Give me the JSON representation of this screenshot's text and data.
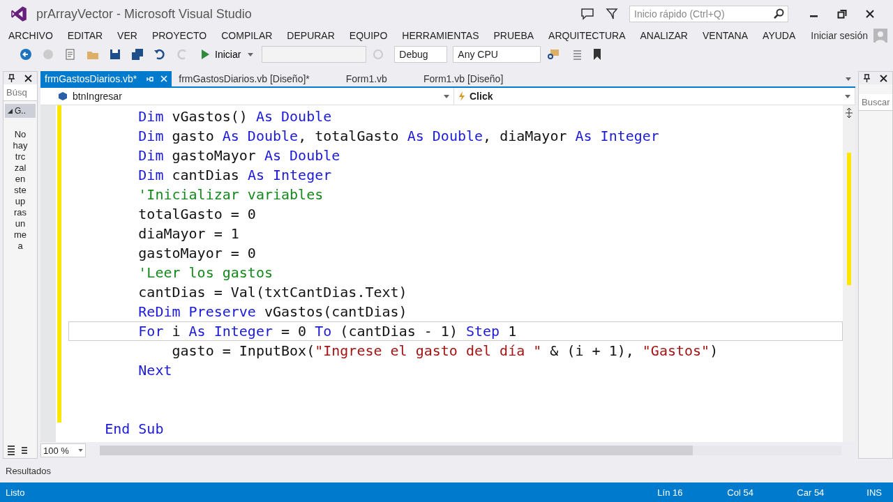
{
  "window": {
    "title": "prArrayVector - Microsoft Visual Studio",
    "quick_launch": {
      "placeholder": "Inicio rápido (Ctrl+Q)"
    }
  },
  "menu": [
    "ARCHIVO",
    "EDITAR",
    "VER",
    "PROYECTO",
    "COMPILAR",
    "DEPURAR",
    "EQUIPO",
    "HERRAMIENTAS",
    "PRUEBA",
    "ARQUITECTURA",
    "ANALIZAR",
    "VENTANA",
    "AYUDA"
  ],
  "sign_in": "Iniciar sesión",
  "toolbar": {
    "start": "Iniciar",
    "configuration": "Debug",
    "platform": "Any CPU"
  },
  "left_panel": {
    "search": {
      "placeholder": "Búsq"
    },
    "group": "G..",
    "message": [
      "No",
      "hay",
      "trc",
      "zal",
      "en",
      "ste",
      "up",
      "ras",
      "un",
      "me",
      "a"
    ]
  },
  "tabs": [
    {
      "label": "frmGastosDiarios.vb*",
      "selected": true
    },
    {
      "label": "frmGastosDiarios.vb [Diseño]*",
      "selected": false
    },
    {
      "label": "Form1.vb",
      "selected": false
    },
    {
      "label": "Form1.vb [Diseño]",
      "selected": false
    }
  ],
  "nav": {
    "object": "btnIngresar",
    "member": "Click"
  },
  "code": [
    {
      "current": false,
      "tokens": [
        {
          "t": "        Dim",
          "kind": "keyword"
        },
        {
          "t": " vGastos() ",
          "kind": "plain"
        },
        {
          "t": "As Double",
          "kind": "keyword"
        }
      ]
    },
    {
      "current": false,
      "tokens": [
        {
          "t": "        Dim",
          "kind": "keyword"
        },
        {
          "t": " gasto ",
          "kind": "plain"
        },
        {
          "t": "As Double",
          "kind": "keyword"
        },
        {
          "t": ", totalGasto ",
          "kind": "plain"
        },
        {
          "t": "As Double",
          "kind": "keyword"
        },
        {
          "t": ", diaMayor ",
          "kind": "plain"
        },
        {
          "t": "As Integer",
          "kind": "keyword"
        }
      ]
    },
    {
      "current": false,
      "tokens": [
        {
          "t": "        Dim",
          "kind": "keyword"
        },
        {
          "t": " gastoMayor ",
          "kind": "plain"
        },
        {
          "t": "As Double",
          "kind": "keyword"
        }
      ]
    },
    {
      "current": false,
      "tokens": [
        {
          "t": "        Dim",
          "kind": "keyword"
        },
        {
          "t": " cantDias ",
          "kind": "plain"
        },
        {
          "t": "As Integer",
          "kind": "keyword"
        }
      ]
    },
    {
      "current": false,
      "tokens": [
        {
          "t": "        'Inicializar variables",
          "kind": "comment"
        }
      ]
    },
    {
      "current": false,
      "tokens": [
        {
          "t": "        totalGasto = 0",
          "kind": "plain"
        }
      ]
    },
    {
      "current": false,
      "tokens": [
        {
          "t": "        diaMayor = 1",
          "kind": "plain"
        }
      ]
    },
    {
      "current": false,
      "tokens": [
        {
          "t": "        gastoMayor = 0",
          "kind": "plain"
        }
      ]
    },
    {
      "current": false,
      "tokens": [
        {
          "t": "        'Leer los gastos",
          "kind": "comment"
        }
      ]
    },
    {
      "current": false,
      "tokens": [
        {
          "t": "        cantDias = Val(txtCantDias.Text)",
          "kind": "plain"
        }
      ]
    },
    {
      "current": false,
      "tokens": [
        {
          "t": "        ReDim Preserve",
          "kind": "keyword"
        },
        {
          "t": " vGastos(cantDias)",
          "kind": "plain"
        }
      ]
    },
    {
      "current": true,
      "tokens": [
        {
          "t": "        For",
          "kind": "keyword"
        },
        {
          "t": " i ",
          "kind": "plain"
        },
        {
          "t": "As Integer",
          "kind": "keyword"
        },
        {
          "t": " = 0 ",
          "kind": "plain"
        },
        {
          "t": "To",
          "kind": "keyword"
        },
        {
          "t": " (cantDias - 1) ",
          "kind": "plain"
        },
        {
          "t": "Step",
          "kind": "keyword"
        },
        {
          "t": " 1",
          "kind": "plain"
        }
      ]
    },
    {
      "current": false,
      "tokens": [
        {
          "t": "            gasto = InputBox(",
          "kind": "plain"
        },
        {
          "t": "\"Ingrese el gasto del día \"",
          "kind": "string"
        },
        {
          "t": " & (i + 1), ",
          "kind": "plain"
        },
        {
          "t": "\"Gastos\"",
          "kind": "string"
        },
        {
          "t": ")",
          "kind": "plain"
        }
      ]
    },
    {
      "current": false,
      "tokens": [
        {
          "t": "        Next",
          "kind": "keyword"
        }
      ]
    },
    {
      "current": false
    },
    {
      "current": false
    },
    {
      "current": false,
      "tokens": [
        {
          "t": "    End Sub",
          "kind": "keyword"
        }
      ]
    }
  ],
  "zoom": "100 %",
  "right_panel": {
    "search": {
      "placeholder": "Buscar"
    }
  },
  "output_tab": "Resultados",
  "status_bar": {
    "message": "Listo",
    "line": "Lín 16",
    "column": "Col 54",
    "char": "Car 54",
    "mode": "INS"
  }
}
